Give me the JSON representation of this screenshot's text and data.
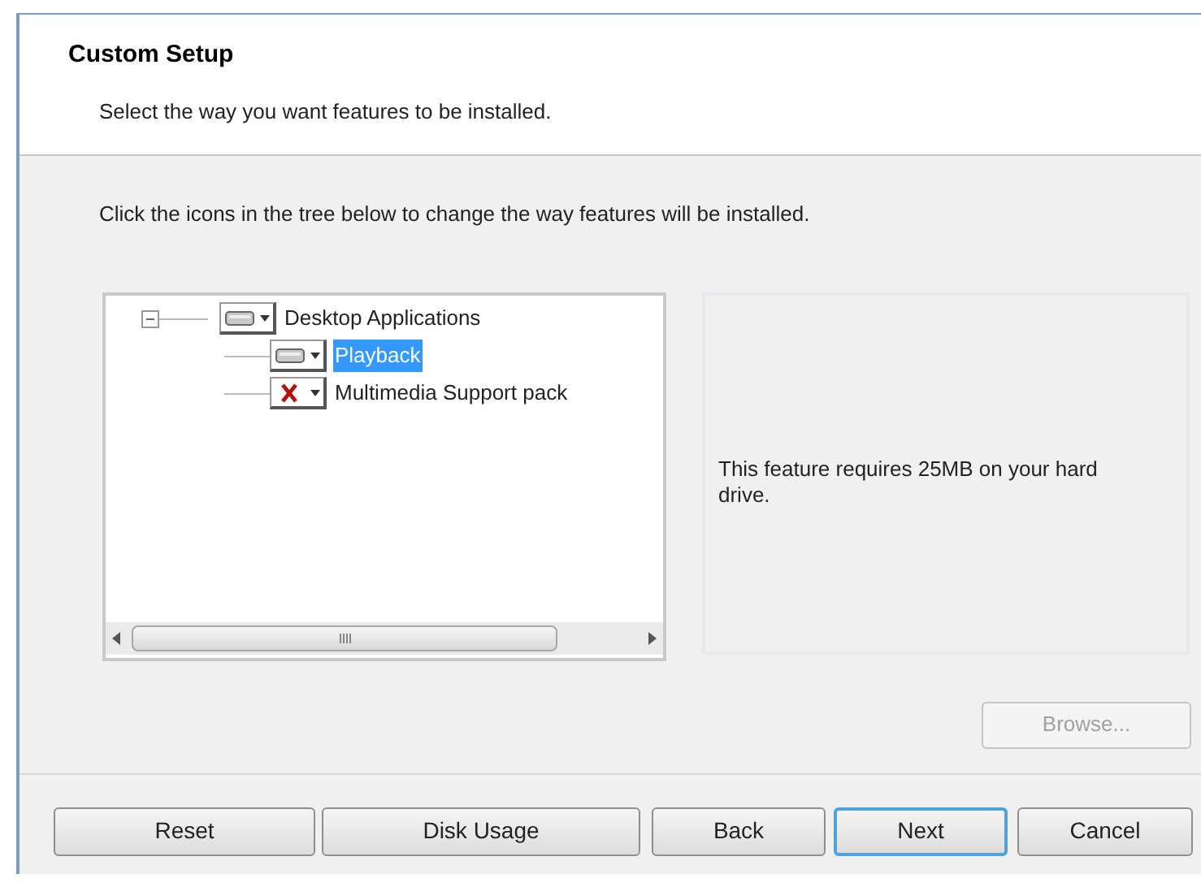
{
  "header": {
    "title": "Custom Setup",
    "subtitle": "Select the way you want features to be installed."
  },
  "instruction": "Click the icons in the tree below to change the way features will be installed.",
  "tree": [
    {
      "label": "Desktop Applications",
      "kind": "install",
      "expanded": true,
      "selected": false,
      "children": [
        {
          "label": "Playback",
          "kind": "install",
          "selected": true
        },
        {
          "label": "Multimedia Support pack",
          "kind": "unavailable",
          "selected": false
        }
      ]
    }
  ],
  "info": "This feature requires 25MB on your hard drive.",
  "browse_button": {
    "label": "Browse...",
    "disabled": true
  },
  "buttons": [
    {
      "label": "Reset",
      "default": false
    },
    {
      "label": "Disk Usage",
      "default": false
    },
    {
      "label": "Back",
      "default": false
    },
    {
      "label": "Next",
      "default": true
    },
    {
      "label": "Cancel",
      "default": false
    }
  ]
}
